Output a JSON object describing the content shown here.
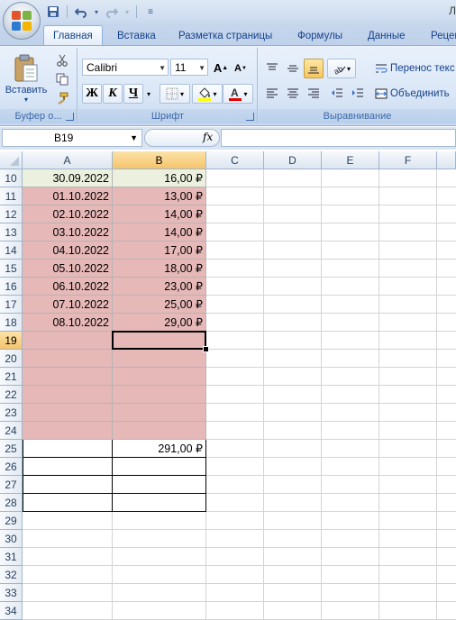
{
  "title_partial": "Л",
  "tabs": [
    "Главная",
    "Вставка",
    "Разметка страницы",
    "Формулы",
    "Данные",
    "Рецен"
  ],
  "ribbon": {
    "paste_label": "Вставить",
    "clipboard_label": "Буфер о...",
    "font_name": "Calibri",
    "font_size": "11",
    "bold": "Ж",
    "italic": "К",
    "underline": "Ч",
    "font_group_label": "Шрифт",
    "wrap_text": "Перенос текс",
    "merge": "Объединить",
    "alignment_label": "Выравнивание"
  },
  "formula_bar": {
    "name_box": "B19",
    "fx": "fx",
    "formula": ""
  },
  "columns": [
    "A",
    "B",
    "C",
    "D",
    "E",
    "F"
  ],
  "selected_cell": "B19",
  "rows": [
    {
      "n": "10",
      "a": "30.09.2022",
      "b": "16,00 ₽"
    },
    {
      "n": "11",
      "a": "01.10.2022",
      "b": "13,00 ₽"
    },
    {
      "n": "12",
      "a": "02.10.2022",
      "b": "14,00 ₽"
    },
    {
      "n": "13",
      "a": "03.10.2022",
      "b": "14,00 ₽"
    },
    {
      "n": "14",
      "a": "04.10.2022",
      "b": "17,00 ₽"
    },
    {
      "n": "15",
      "a": "05.10.2022",
      "b": "18,00 ₽"
    },
    {
      "n": "16",
      "a": "06.10.2022",
      "b": "23,00 ₽"
    },
    {
      "n": "17",
      "a": "07.10.2022",
      "b": "25,00 ₽"
    },
    {
      "n": "18",
      "a": "08.10.2022",
      "b": "29,00 ₽"
    },
    {
      "n": "19",
      "a": "",
      "b": ""
    },
    {
      "n": "20",
      "a": "",
      "b": ""
    },
    {
      "n": "21",
      "a": "",
      "b": ""
    },
    {
      "n": "22",
      "a": "",
      "b": ""
    },
    {
      "n": "23",
      "a": "",
      "b": ""
    },
    {
      "n": "24",
      "a": "",
      "b": ""
    },
    {
      "n": "25",
      "a": "",
      "b": "291,00 ₽"
    },
    {
      "n": "26",
      "a": "",
      "b": ""
    },
    {
      "n": "27",
      "a": "",
      "b": ""
    },
    {
      "n": "28",
      "a": "",
      "b": ""
    },
    {
      "n": "29",
      "a": "",
      "b": ""
    },
    {
      "n": "30",
      "a": "",
      "b": ""
    },
    {
      "n": "31",
      "a": "",
      "b": ""
    },
    {
      "n": "32",
      "a": "",
      "b": ""
    },
    {
      "n": "33",
      "a": "",
      "b": ""
    },
    {
      "n": "34",
      "a": "",
      "b": ""
    }
  ],
  "colors": {
    "green_fill": "#ebf1de",
    "pink_fill": "#e6b8b7",
    "header_selected": "#f6c46b",
    "ribbon_text": "#15428b"
  }
}
